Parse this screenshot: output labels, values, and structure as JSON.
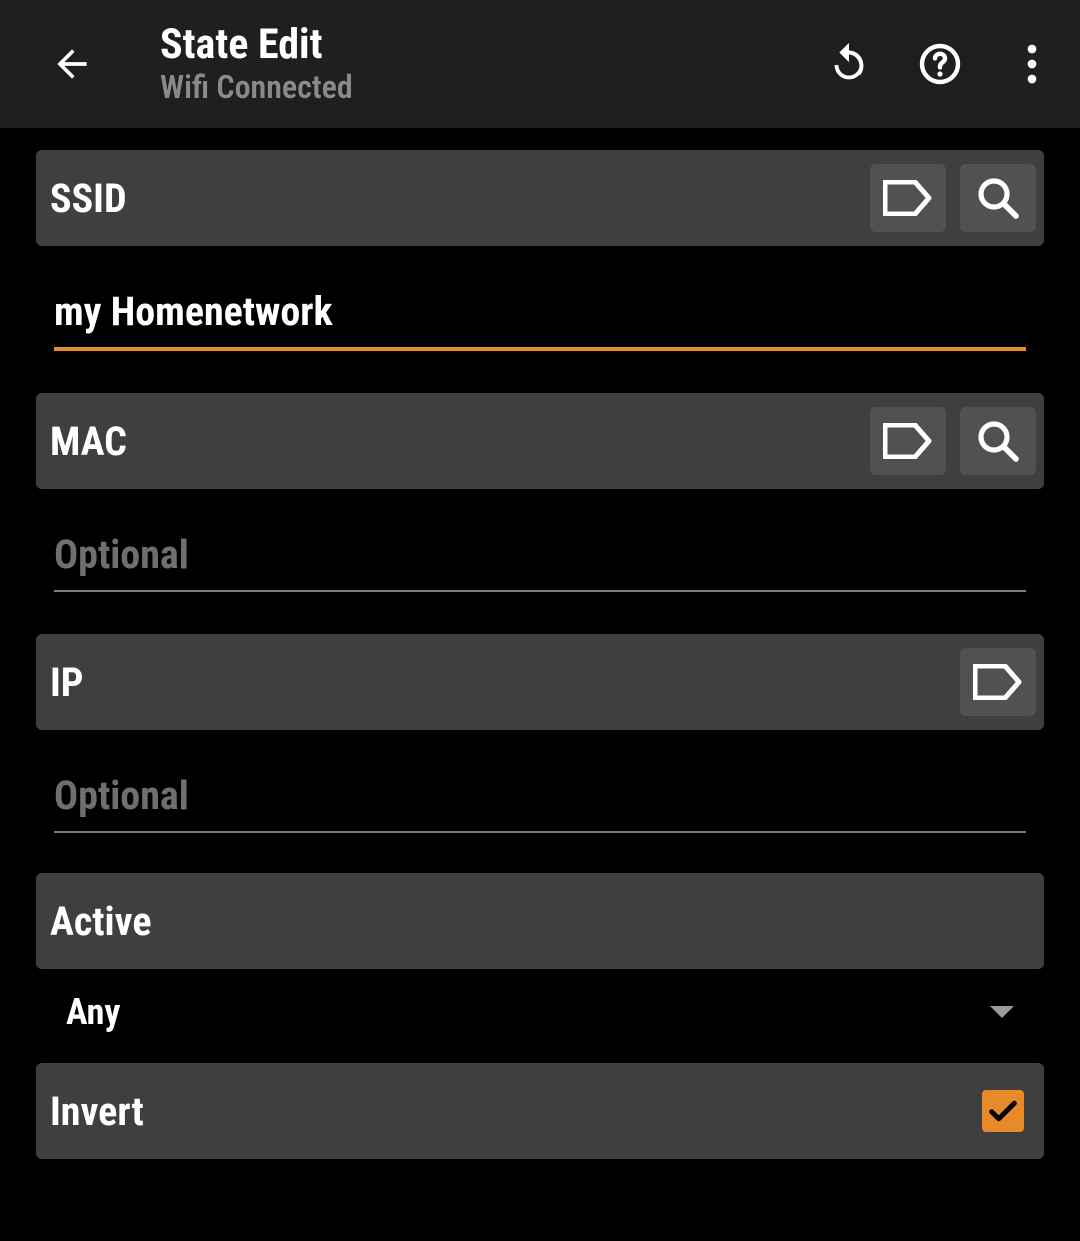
{
  "header": {
    "title": "State Edit",
    "subtitle": "Wifi Connected"
  },
  "ssid": {
    "label": "SSID",
    "value": "my Homenetwork"
  },
  "mac": {
    "label": "MAC",
    "value": "",
    "placeholder": "Optional"
  },
  "ip": {
    "label": "IP",
    "value": "",
    "placeholder": "Optional"
  },
  "active": {
    "label": "Active",
    "value": "Any"
  },
  "invert": {
    "label": "Invert",
    "checked": true
  }
}
